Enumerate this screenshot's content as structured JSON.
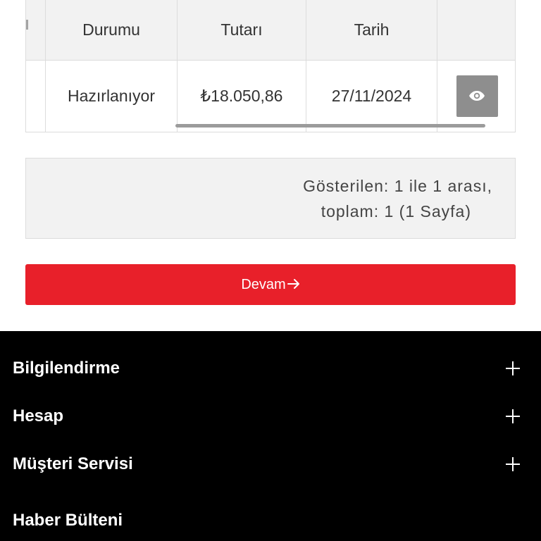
{
  "table": {
    "headers": [
      "",
      "Durumu",
      "Tutarı",
      "Tarih",
      ""
    ],
    "rows": [
      {
        "status": "Hazırlanıyor",
        "amount": "₺18.050,86",
        "date": "27/11/2024",
        "action_icon": "eye-icon"
      }
    ]
  },
  "pagination": {
    "line1": "Gösterilen: 1 ile 1 arası,",
    "line2": "toplam: 1 (1 Sayfa)"
  },
  "continue_button": {
    "label": "Devam",
    "icon": "arrow-right-icon",
    "color": "#e8202a"
  },
  "footer": {
    "background": "#000000",
    "sections": [
      {
        "label": "Bilgilendirme",
        "icon": "plus-icon"
      },
      {
        "label": "Hesap",
        "icon": "plus-icon"
      },
      {
        "label": "Müşteri Servisi",
        "icon": "plus-icon"
      }
    ],
    "newsletter_title": "Haber Bülteni"
  }
}
